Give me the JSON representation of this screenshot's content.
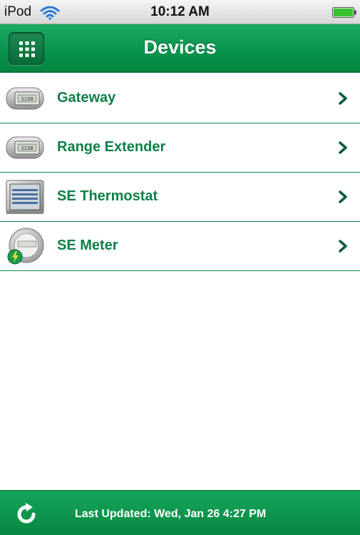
{
  "status_bar": {
    "carrier": "iPod",
    "time": "10:12 AM",
    "icons": [
      "wifi-icon",
      "battery-icon"
    ]
  },
  "nav": {
    "title": "Devices",
    "menu_icon": "grid-icon"
  },
  "devices": [
    {
      "label": "Gateway",
      "icon": "gateway-device-icon"
    },
    {
      "label": "Range Extender",
      "icon": "range-extender-device-icon"
    },
    {
      "label": "SE Thermostat",
      "icon": "thermostat-device-icon"
    },
    {
      "label": "SE Meter",
      "icon": "meter-device-icon"
    }
  ],
  "toolbar": {
    "last_updated": "Last Updated: Wed, Jan 26 4:27 PM",
    "refresh_icon": "refresh-icon"
  },
  "colors": {
    "brand_green": "#0b9650",
    "label_green": "#0d8048",
    "chevron_green": "#0a5c3a"
  }
}
